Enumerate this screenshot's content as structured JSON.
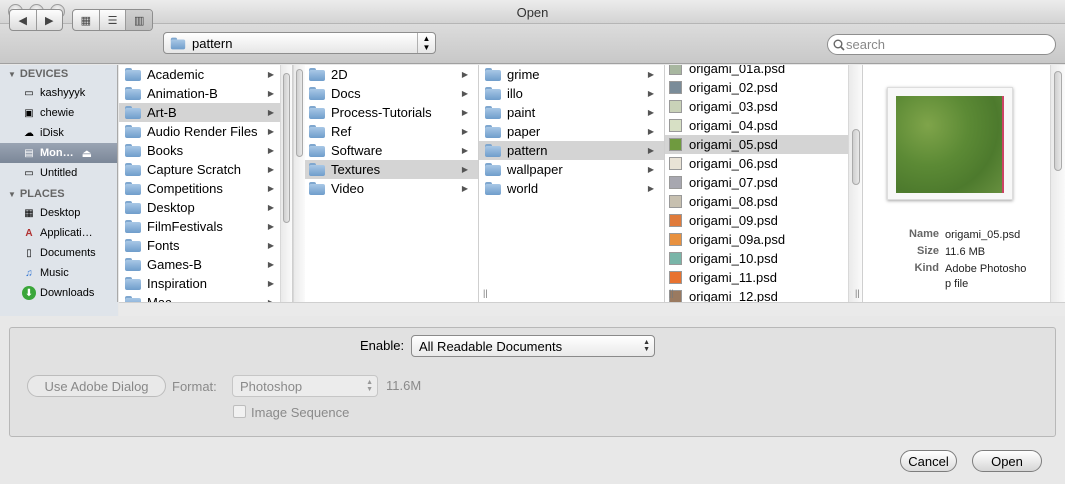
{
  "window": {
    "title": "Open"
  },
  "toolbar": {
    "path_popup": "pattern",
    "search_placeholder": "search"
  },
  "sidebar": {
    "devices_header": "DEVICES",
    "devices": [
      {
        "label": "kashyyyk",
        "icon": "hard-drive-icon"
      },
      {
        "label": "chewie",
        "icon": "computer-icon"
      },
      {
        "label": "iDisk",
        "icon": "idisk-icon"
      },
      {
        "label": "Mon…",
        "icon": "network-drive-icon",
        "selected": true
      },
      {
        "label": "Untitled",
        "icon": "hard-drive-icon"
      }
    ],
    "places_header": "PLACES",
    "places": [
      {
        "label": "Desktop",
        "icon": "desktop-icon"
      },
      {
        "label": "Applicati…",
        "icon": "applications-icon"
      },
      {
        "label": "Documents",
        "icon": "documents-icon"
      },
      {
        "label": "Music",
        "icon": "music-icon"
      },
      {
        "label": "Downloads",
        "icon": "downloads-icon"
      }
    ]
  },
  "columns": {
    "col1": [
      "Academic",
      "Animation-B",
      "Art-B",
      "Audio Render Files",
      "Books",
      "Capture Scratch",
      "Competitions",
      "Desktop",
      "FilmFestivals",
      "Fonts",
      "Games-B",
      "Inspiration",
      "Mac"
    ],
    "col1_selected": 2,
    "col2": [
      "2D",
      "Docs",
      "Process-Tutorials",
      "Ref",
      "Software",
      "Textures",
      "Video"
    ],
    "col2_selected": 5,
    "col3": [
      "grime",
      "illo",
      "paint",
      "paper",
      "pattern",
      "wallpaper",
      "world"
    ],
    "col3_selected": 4,
    "col4": [
      {
        "name": "origami_01a.psd",
        "color": "#a8b7a0"
      },
      {
        "name": "origami_02.psd",
        "color": "#7a8c99"
      },
      {
        "name": "origami_03.psd",
        "color": "#c9d2b8"
      },
      {
        "name": "origami_04.psd",
        "color": "#d7e0c5"
      },
      {
        "name": "origami_05.psd",
        "color": "#6f9a3f"
      },
      {
        "name": "origami_06.psd",
        "color": "#e9e3d6"
      },
      {
        "name": "origami_07.psd",
        "color": "#a7a7b0"
      },
      {
        "name": "origami_08.psd",
        "color": "#c7c0b0"
      },
      {
        "name": "origami_09.psd",
        "color": "#e07b3b"
      },
      {
        "name": "origami_09a.psd",
        "color": "#e8913f"
      },
      {
        "name": "origami_10.psd",
        "color": "#79b5a8"
      },
      {
        "name": "origami_11.psd",
        "color": "#e8722f"
      },
      {
        "name": "origami_12.psd",
        "color": "#9a7a60"
      }
    ],
    "col4_selected": 4
  },
  "preview": {
    "name_key": "Name",
    "name_value": "origami_05.psd",
    "size_key": "Size",
    "size_value": "11.6 MB",
    "kind_key": "Kind",
    "kind_value": "Adobe Photoshop file"
  },
  "options": {
    "enable_label": "Enable:",
    "enable_value": "All Readable Documents",
    "use_adobe_dialog": "Use Adobe Dialog",
    "format_label": "Format:",
    "format_value": "Photoshop",
    "format_size": "11.6M",
    "image_sequence": "Image Sequence"
  },
  "buttons": {
    "cancel": "Cancel",
    "open": "Open"
  }
}
